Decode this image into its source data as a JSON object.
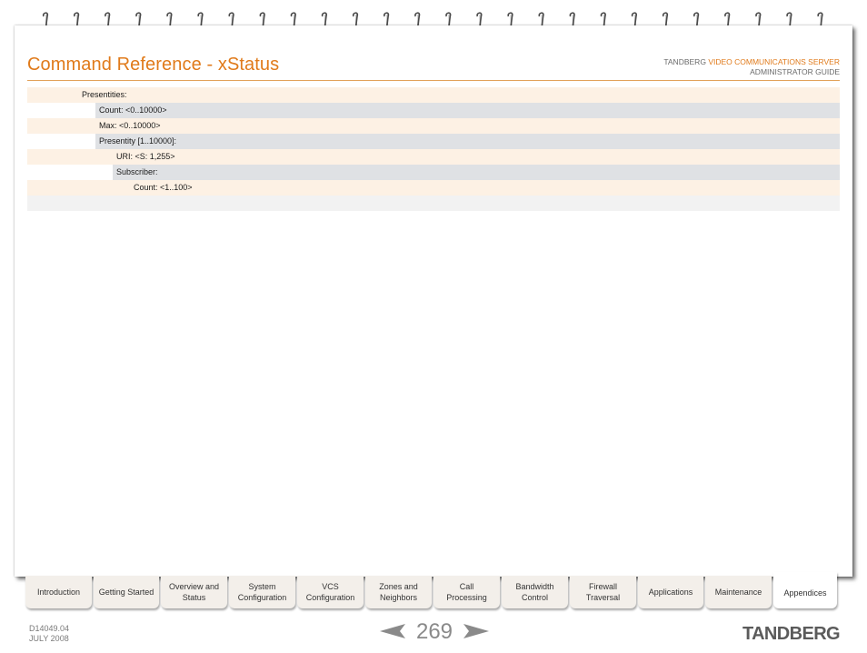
{
  "header": {
    "title": "Command Reference - xStatus",
    "brand": "TANDBERG",
    "product": "VIDEO COMMUNICATIONS SERVER",
    "guide": "ADMINISTRATOR GUIDE"
  },
  "tree": [
    {
      "label": "Presentities:",
      "level": 1,
      "band": "cream"
    },
    {
      "label": "Count: <0..10000>",
      "level": 2,
      "band": "gray"
    },
    {
      "label": "Max: <0..10000>",
      "level": 2,
      "band": "cream"
    },
    {
      "label": "Presentity [1..10000]:",
      "level": 2,
      "band": "gray"
    },
    {
      "label": "URI: <S: 1,255>",
      "level": 3,
      "band": "cream"
    },
    {
      "label": "Subscriber:",
      "level": 3,
      "band": "gray"
    },
    {
      "label": "Count: <1..100>",
      "level": 4,
      "band": "cream"
    }
  ],
  "tabs": [
    {
      "label": "Introduction"
    },
    {
      "label": "Getting Started"
    },
    {
      "label": "Overview and\nStatus"
    },
    {
      "label": "System\nConfiguration"
    },
    {
      "label": "VCS\nConfiguration"
    },
    {
      "label": "Zones and\nNeighbors"
    },
    {
      "label": "Call\nProcessing"
    },
    {
      "label": "Bandwidth\nControl"
    },
    {
      "label": "Firewall\nTraversal"
    },
    {
      "label": "Applications"
    },
    {
      "label": "Maintenance"
    },
    {
      "label": "Appendices",
      "active": true
    }
  ],
  "footer": {
    "doc_number": "D14049.04",
    "date": "JULY 2008",
    "page_number": "269",
    "logo_text": "TANDBERG"
  },
  "colors": {
    "accent": "#e07a1a",
    "row_cream": "#fdf1e4",
    "row_gray": "#dfe1e4"
  },
  "icons": {
    "binding": "spiral-ring-icon",
    "prev": "arrow-left-icon",
    "next": "arrow-right-icon"
  }
}
